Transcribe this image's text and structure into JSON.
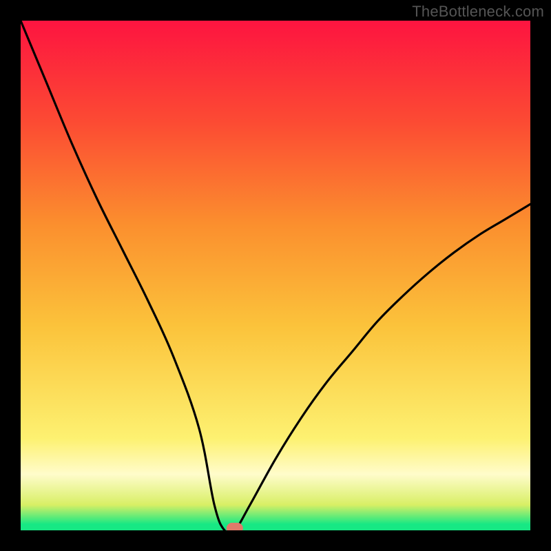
{
  "watermark": "TheBottleneck.com",
  "chart_data": {
    "type": "line",
    "title": "",
    "xlabel": "",
    "ylabel": "",
    "xlim": [
      0,
      100
    ],
    "ylim": [
      0,
      100
    ],
    "x": [
      0,
      5,
      10,
      15,
      20,
      25,
      30,
      35,
      38,
      40,
      42,
      45,
      50,
      55,
      60,
      65,
      70,
      75,
      80,
      85,
      90,
      95,
      100
    ],
    "values": [
      100,
      88,
      76,
      65,
      55,
      45,
      34,
      20,
      5,
      0,
      0,
      5,
      14,
      22,
      29,
      35,
      41,
      46,
      50.5,
      54.5,
      58,
      61,
      64
    ],
    "annotations": {
      "marker": {
        "x": 42,
        "y": 0,
        "shape": "rounded-rect",
        "color": "#e07a6a"
      }
    },
    "background_gradient": {
      "bottom_band": "#17e884",
      "yellow": "#fbe749",
      "orange": "#fb8f2e",
      "red": "#fd1440"
    },
    "curve_color": "#000000"
  }
}
